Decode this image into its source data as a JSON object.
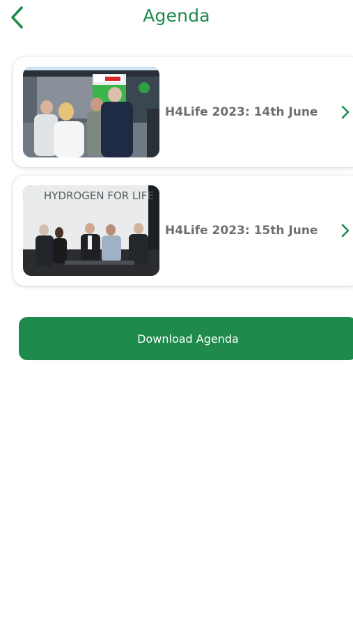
{
  "header": {
    "title": "Agenda",
    "back_icon": "chevron-left-icon"
  },
  "agenda_items": [
    {
      "label": "H4Life 2023: 14th June",
      "thumbnail": "exhibition-booth-photo",
      "chevron_icon": "chevron-right-icon"
    },
    {
      "label": "H4Life 2023: 15th June",
      "thumbnail": "panel-discussion-photo",
      "thumbnail_text": "HYDROGEN FOR LIFE",
      "chevron_icon": "chevron-right-icon"
    }
  ],
  "download": {
    "label": "Download Agenda"
  },
  "colors": {
    "accent": "#1e8a4b",
    "label_text": "#6e6e6e",
    "background": "#ffffff"
  }
}
